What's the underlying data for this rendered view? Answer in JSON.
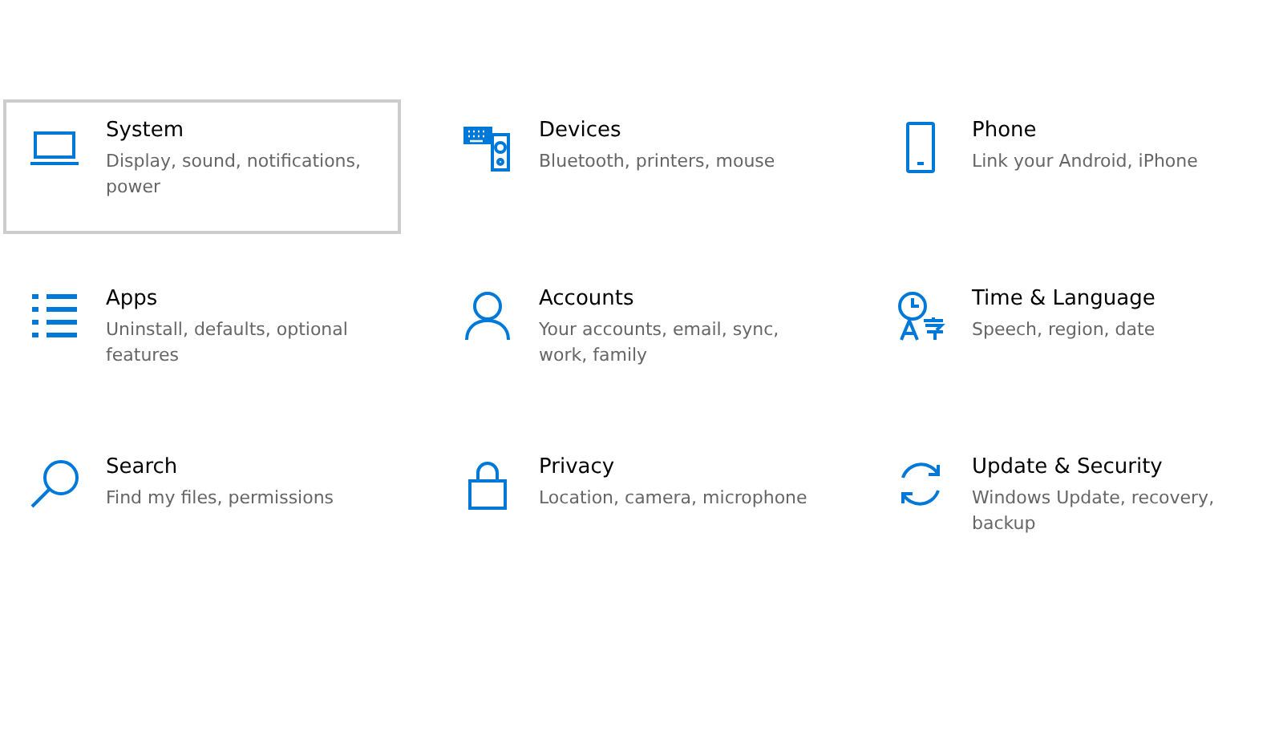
{
  "settings": [
    {
      "kind": "laptop",
      "title": "System",
      "description": "Display, sound, notifications, power",
      "selected": true
    },
    {
      "kind": "devices",
      "title": "Devices",
      "description": "Bluetooth, printers, mouse",
      "selected": false
    },
    {
      "kind": "phone",
      "title": "Phone",
      "description": "Link your Android, iPhone",
      "selected": false
    },
    {
      "kind": "apps",
      "title": "Apps",
      "description": "Uninstall, defaults, optional features",
      "selected": false
    },
    {
      "kind": "person",
      "title": "Accounts",
      "description": "Your accounts, email, sync, work, family",
      "selected": false
    },
    {
      "kind": "time",
      "title": "Time & Language",
      "description": "Speech, region, date",
      "selected": false
    },
    {
      "kind": "search",
      "title": "Search",
      "description": "Find my files, permissions",
      "selected": false
    },
    {
      "kind": "lock",
      "title": "Privacy",
      "description": "Location, camera, microphone",
      "selected": false
    },
    {
      "kind": "sync",
      "title": "Update & Security",
      "description": "Windows Update, recovery, backup",
      "selected": false
    }
  ]
}
